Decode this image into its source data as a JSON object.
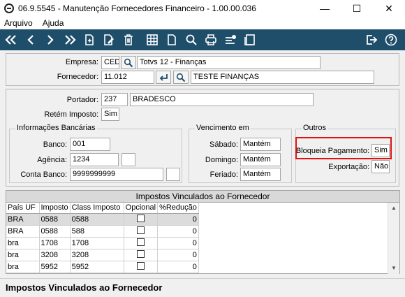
{
  "window": {
    "title": "06.9.5545 - Manutenção Fornecedores Financeiro - 1.00.00.036",
    "minimize": "—",
    "maximize": "☐",
    "close": "✕"
  },
  "menu": [
    "Arquivo",
    "Ajuda"
  ],
  "header": {
    "empresa_label": "Empresa:",
    "empresa_code": "CED",
    "empresa_name": "Totvs 12 - Finanças",
    "fornecedor_label": "Fornecedor:",
    "fornecedor_code": "11.012",
    "fornecedor_name": "TESTE FINANÇAS"
  },
  "details": {
    "portador_label": "Portador:",
    "portador_code": "237",
    "portador_name": "BRADESCO",
    "retem_label": "Retém Imposto:",
    "retem_value": "Sim"
  },
  "banking": {
    "title": "Informações Bancárias",
    "banco_label": "Banco:",
    "banco_value": "001",
    "agencia_label": "Agência:",
    "agencia_value": "1234",
    "conta_label": "Conta Banco:",
    "conta_value": "9999999999"
  },
  "vencimento": {
    "title": "Vencimento em",
    "sabado_label": "Sábado:",
    "sabado_value": "Mantém",
    "domingo_label": "Domingo:",
    "domingo_value": "Mantém",
    "feriado_label": "Feriado:",
    "feriado_value": "Mantém"
  },
  "outros": {
    "title": "Outros",
    "bloqueia_label": "Bloqueia Pagamento:",
    "bloqueia_value": "Sim",
    "exportacao_label": "Exportação:",
    "exportacao_value": "Não"
  },
  "grid": {
    "title": "Impostos Vinculados ao Fornecedor",
    "columns": [
      "País UF",
      "Imposto",
      "Class Imposto",
      "Opcional",
      "%Redução"
    ],
    "rows": [
      {
        "pais": "BRA",
        "imposto": "0588",
        "classe": "0588",
        "reducao": "0"
      },
      {
        "pais": "BRA",
        "imposto": "0588",
        "classe": "588",
        "reducao": "0"
      },
      {
        "pais": "bra",
        "imposto": "1708",
        "classe": "1708",
        "reducao": "0"
      },
      {
        "pais": "bra",
        "imposto": "3208",
        "classe": "3208",
        "reducao": "0"
      },
      {
        "pais": "bra",
        "imposto": "5952",
        "classe": "5952",
        "reducao": "0"
      }
    ]
  },
  "status": {
    "text": "Impostos Vinculados ao Fornecedor"
  },
  "toolbar": {
    "icons": [
      "first-icon",
      "previous-icon",
      "next-icon",
      "last-icon",
      "copy-icon",
      "edit-icon",
      "delete-icon",
      "grid-icon",
      "new-document-icon",
      "search-icon",
      "print-icon",
      "list-icon",
      "notes-icon",
      "exit-icon",
      "help-icon"
    ]
  }
}
